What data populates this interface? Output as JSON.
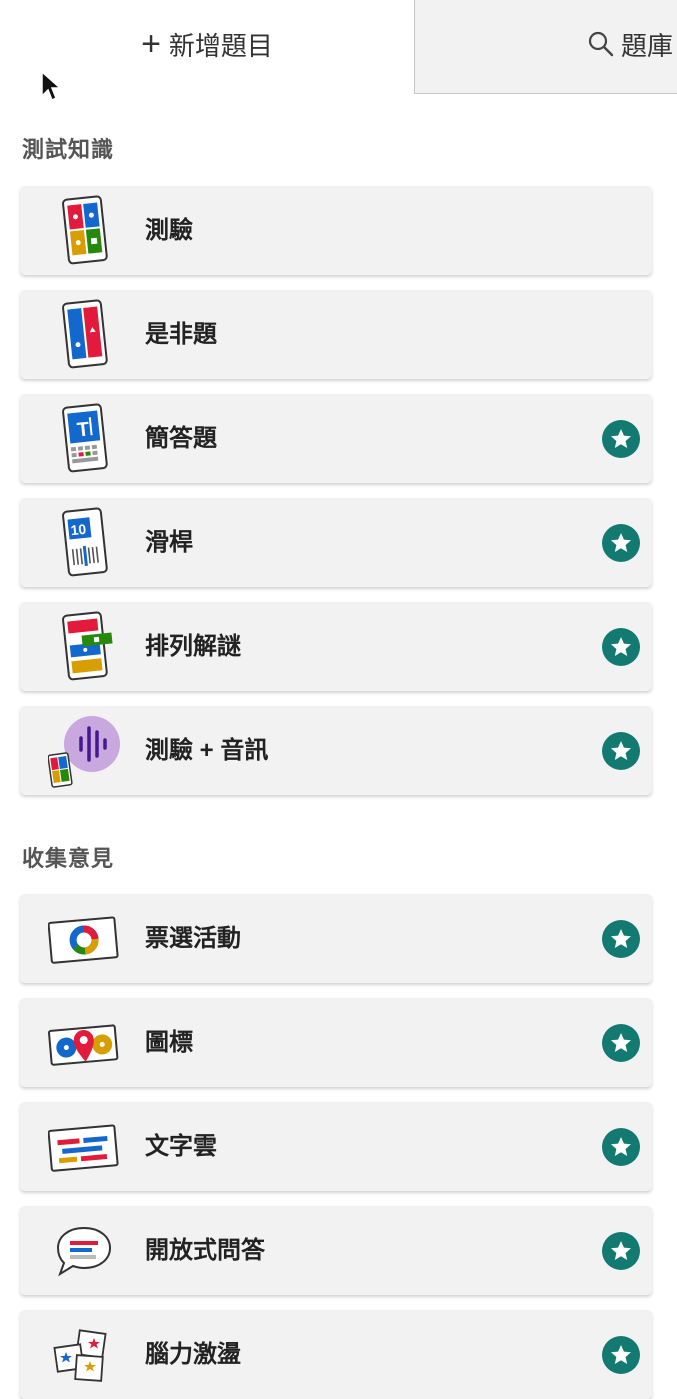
{
  "tabs": {
    "add_label": "新增題目",
    "bank_label": "題庫"
  },
  "sections": {
    "knowledge": {
      "title": "測試知識"
    },
    "opinions": {
      "title": "收集意見"
    }
  },
  "knowledge_items": [
    {
      "label": "測驗",
      "icon": "quiz-icon",
      "premium": false
    },
    {
      "label": "是非題",
      "icon": "true-false-icon",
      "premium": false
    },
    {
      "label": "簡答題",
      "icon": "type-answer-icon",
      "premium": true
    },
    {
      "label": "滑桿",
      "icon": "slider-icon",
      "premium": true
    },
    {
      "label": "排列解謎",
      "icon": "puzzle-icon",
      "premium": true
    },
    {
      "label": "測驗 + 音訊",
      "icon": "quiz-audio-icon",
      "premium": true
    }
  ],
  "opinion_items": [
    {
      "label": "票選活動",
      "icon": "poll-icon",
      "premium": true
    },
    {
      "label": "圖標",
      "icon": "pin-icon",
      "premium": true
    },
    {
      "label": "文字雲",
      "icon": "word-cloud-icon",
      "premium": true
    },
    {
      "label": "開放式問答",
      "icon": "open-ended-icon",
      "premium": true
    },
    {
      "label": "腦力激盪",
      "icon": "brainstorm-icon",
      "premium": true
    }
  ],
  "colors": {
    "accent": "#137a72",
    "card_bg": "#f2f2f2",
    "red": "#e21b3c",
    "blue": "#1368ce",
    "yellow": "#d89e00",
    "green": "#26890c"
  }
}
